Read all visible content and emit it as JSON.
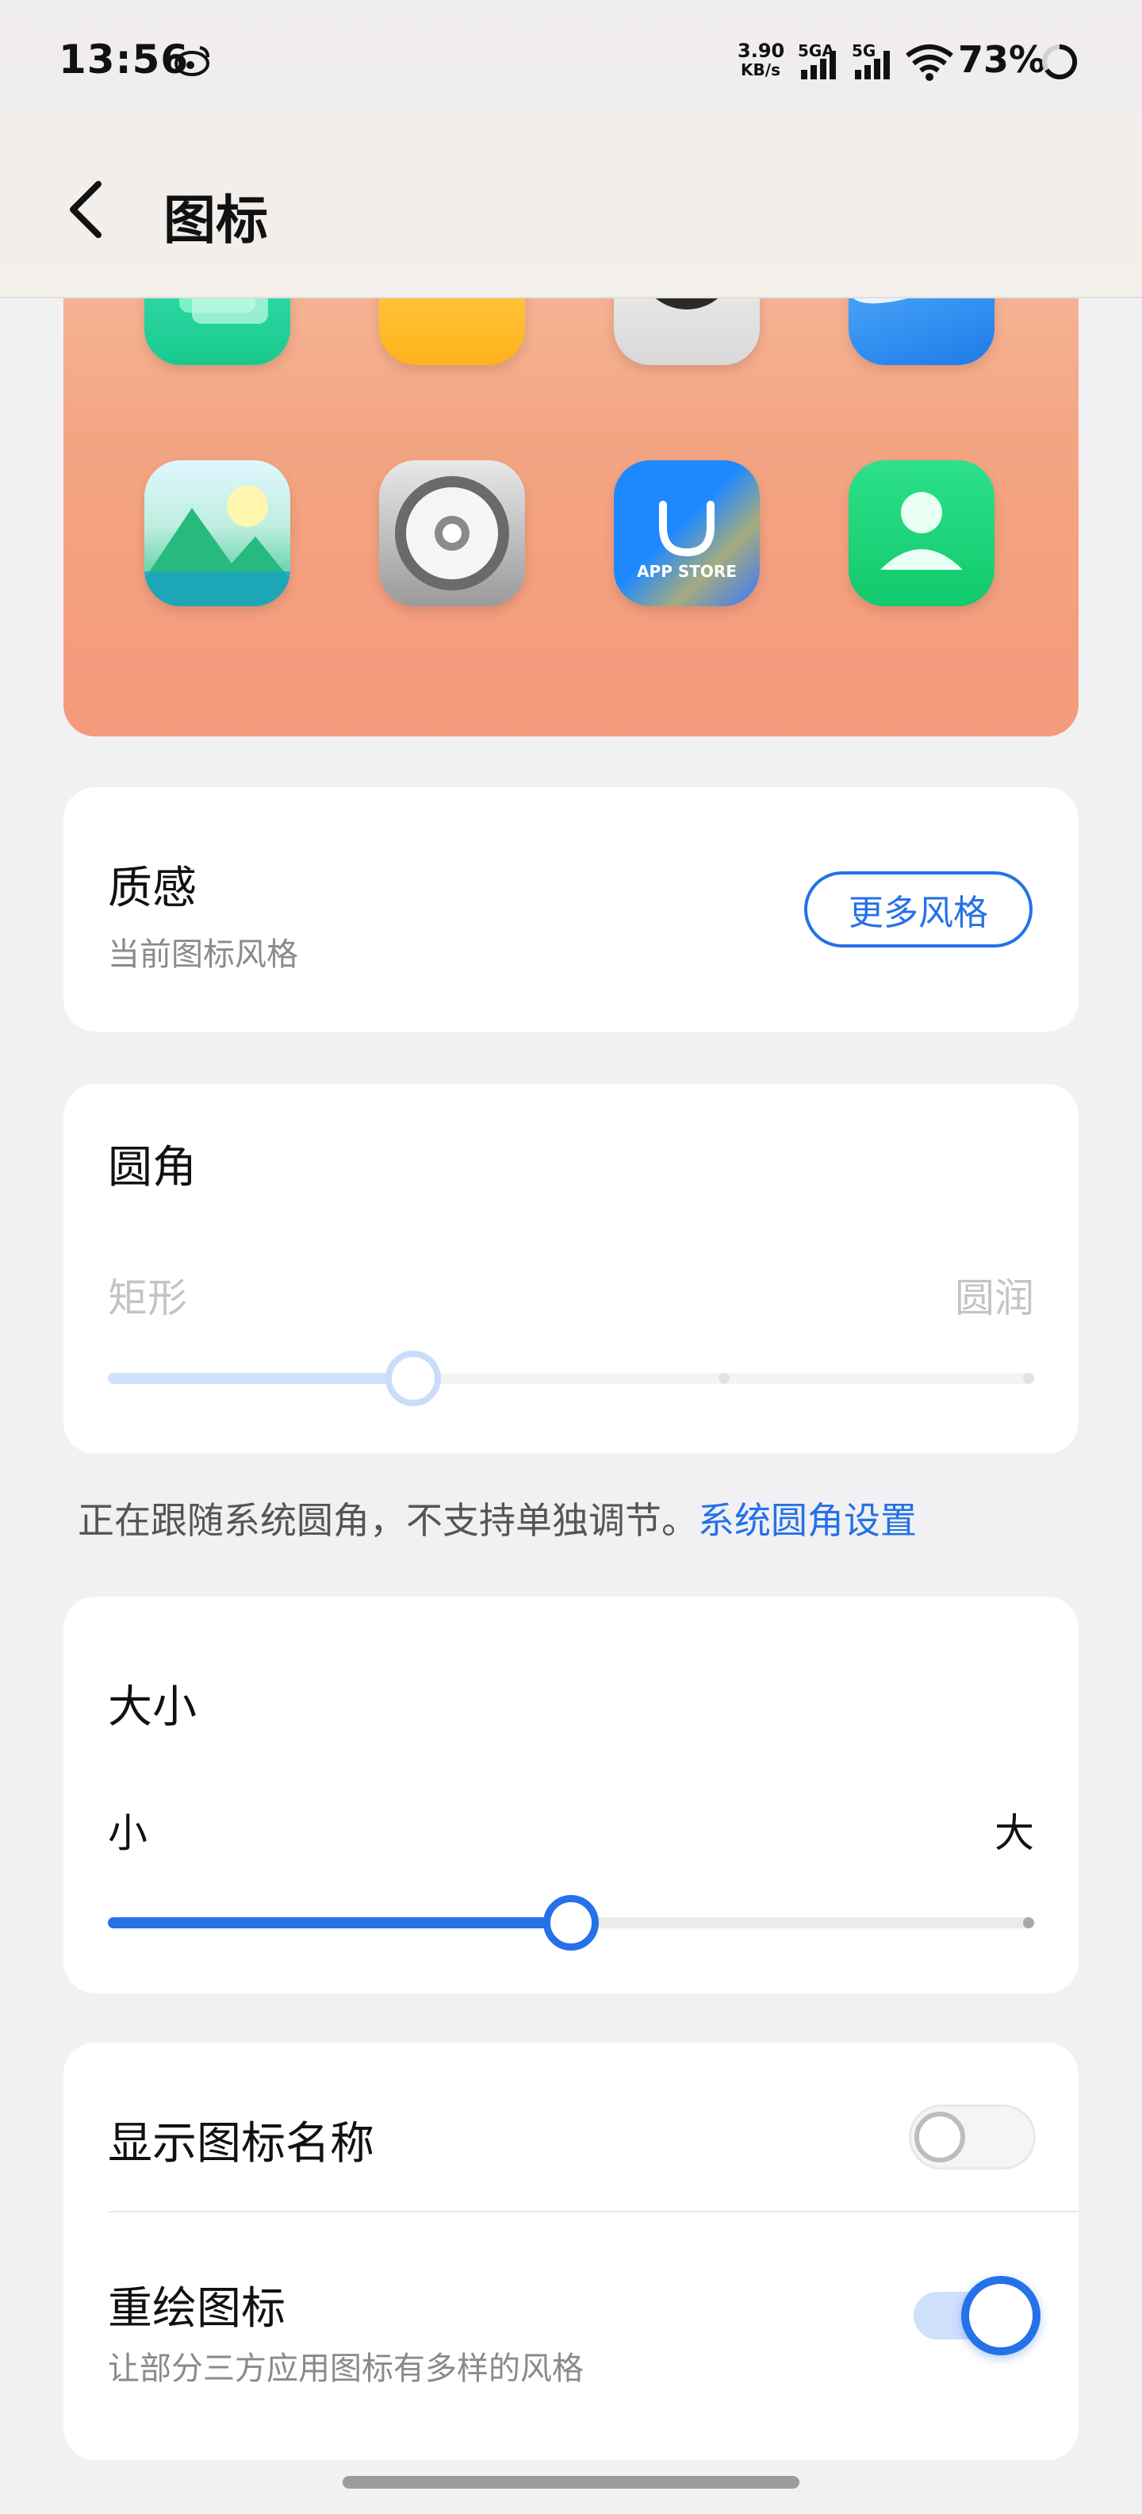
{
  "status_bar": {
    "time": "13:56",
    "net_speed_value": "3.90",
    "net_speed_unit": "KB/s",
    "sim1": "5GA",
    "sim2": "5G",
    "battery": "73%"
  },
  "header": {
    "title": "图标"
  },
  "preview": {
    "icons": [
      "messages-icon",
      "files-icon",
      "camera-icon",
      "browser-icon",
      "gallery-icon",
      "settings-icon",
      "app-store-icon",
      "contacts-icon"
    ],
    "app_store_label": "APP STORE"
  },
  "style_card": {
    "title": "质感",
    "subtitle": "当前图标风格",
    "button": "更多风格"
  },
  "corner_card": {
    "title": "圆角",
    "min_label": "矩形",
    "max_label": "圆润",
    "value_fraction": 0.33,
    "enabled": false
  },
  "corner_note": {
    "text": "正在跟随系统圆角，不支持单独调节。",
    "link": "系统圆角设置"
  },
  "size_card": {
    "title": "大小",
    "min_label": "小",
    "max_label": "大",
    "value_fraction": 0.5
  },
  "toggles": {
    "show_names": {
      "label": "显示图标名称",
      "on": false
    },
    "redraw": {
      "label": "重绘图标",
      "desc": "让部分三方应用图标有多样的风格",
      "on": true
    }
  },
  "colors": {
    "accent": "#2571e8"
  }
}
